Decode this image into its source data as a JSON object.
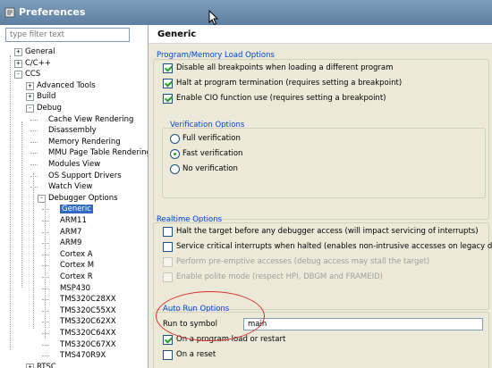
{
  "window": {
    "title": "Preferences"
  },
  "filter": {
    "placeholder": "type filter text"
  },
  "tree": [
    {
      "label": "General",
      "exp": "+"
    },
    {
      "label": "C/C++",
      "exp": "+"
    },
    {
      "label": "CCS",
      "exp": "-"
    },
    {
      "label": "Advanced Tools",
      "exp": "+"
    },
    {
      "label": "Build",
      "exp": "+"
    },
    {
      "label": "Debug",
      "exp": "-"
    },
    {
      "label": "Cache View Rendering"
    },
    {
      "label": "Disassembly"
    },
    {
      "label": "Memory Rendering"
    },
    {
      "label": "MMU Page Table Rendering"
    },
    {
      "label": "Modules View"
    },
    {
      "label": "OS Support Drivers"
    },
    {
      "label": "Watch View"
    },
    {
      "label": "Debugger Options",
      "exp": "-"
    },
    {
      "label": "Generic",
      "selected": true
    },
    {
      "label": "ARM11"
    },
    {
      "label": "ARM7"
    },
    {
      "label": "ARM9"
    },
    {
      "label": "Cortex A"
    },
    {
      "label": "Cortex M"
    },
    {
      "label": "Cortex R"
    },
    {
      "label": "MSP430"
    },
    {
      "label": "TMS320C28XX"
    },
    {
      "label": "TMS320C55XX"
    },
    {
      "label": "TMS320C62XX"
    },
    {
      "label": "TMS320C64XX"
    },
    {
      "label": "TMS320C67XX"
    },
    {
      "label": "TMS470R9X"
    },
    {
      "label": "RTSC",
      "exp": "+"
    }
  ],
  "page": {
    "title": "Generic"
  },
  "program_memory": {
    "title": "Program/Memory Load Options",
    "options": [
      {
        "label": "Disable all breakpoints when loading a different program",
        "checked": true
      },
      {
        "label": "Halt at program termination (requires setting a breakpoint)",
        "checked": true
      },
      {
        "label": "Enable CIO function use (requires setting a breakpoint)",
        "checked": true
      }
    ]
  },
  "verification": {
    "title": "Verification Options",
    "options": [
      {
        "label": "Full verification",
        "checked": false
      },
      {
        "label": "Fast verification",
        "checked": true
      },
      {
        "label": "No verification",
        "checked": false
      }
    ]
  },
  "realtime": {
    "title": "Realtime Options",
    "options": [
      {
        "label": "Halt the target before any debugger access (will impact servicing of interrupts)",
        "checked": false,
        "disabled": false
      },
      {
        "label": "Service critical interrupts when halted (enables non-intrusive accesses on legacy drivers)",
        "checked": false,
        "disabled": false
      },
      {
        "label": "Perform pre-emptive accesses (debug access may stall the target)",
        "checked": false,
        "disabled": true
      },
      {
        "label": "Enable polite mode (respect HPI, DBGM and FRAMEID)",
        "checked": false,
        "disabled": true
      }
    ]
  },
  "auto_run": {
    "title": "Auto Run Options",
    "run_to_symbol_label": "Run to symbol",
    "run_to_symbol_value": "main",
    "options": [
      {
        "label": "On a program load or restart",
        "checked": true
      },
      {
        "label": "On a reset",
        "checked": false
      }
    ]
  },
  "colors": {
    "selection": "#316ac5",
    "group_title": "#0046d5",
    "annotation": "#d9302c"
  }
}
